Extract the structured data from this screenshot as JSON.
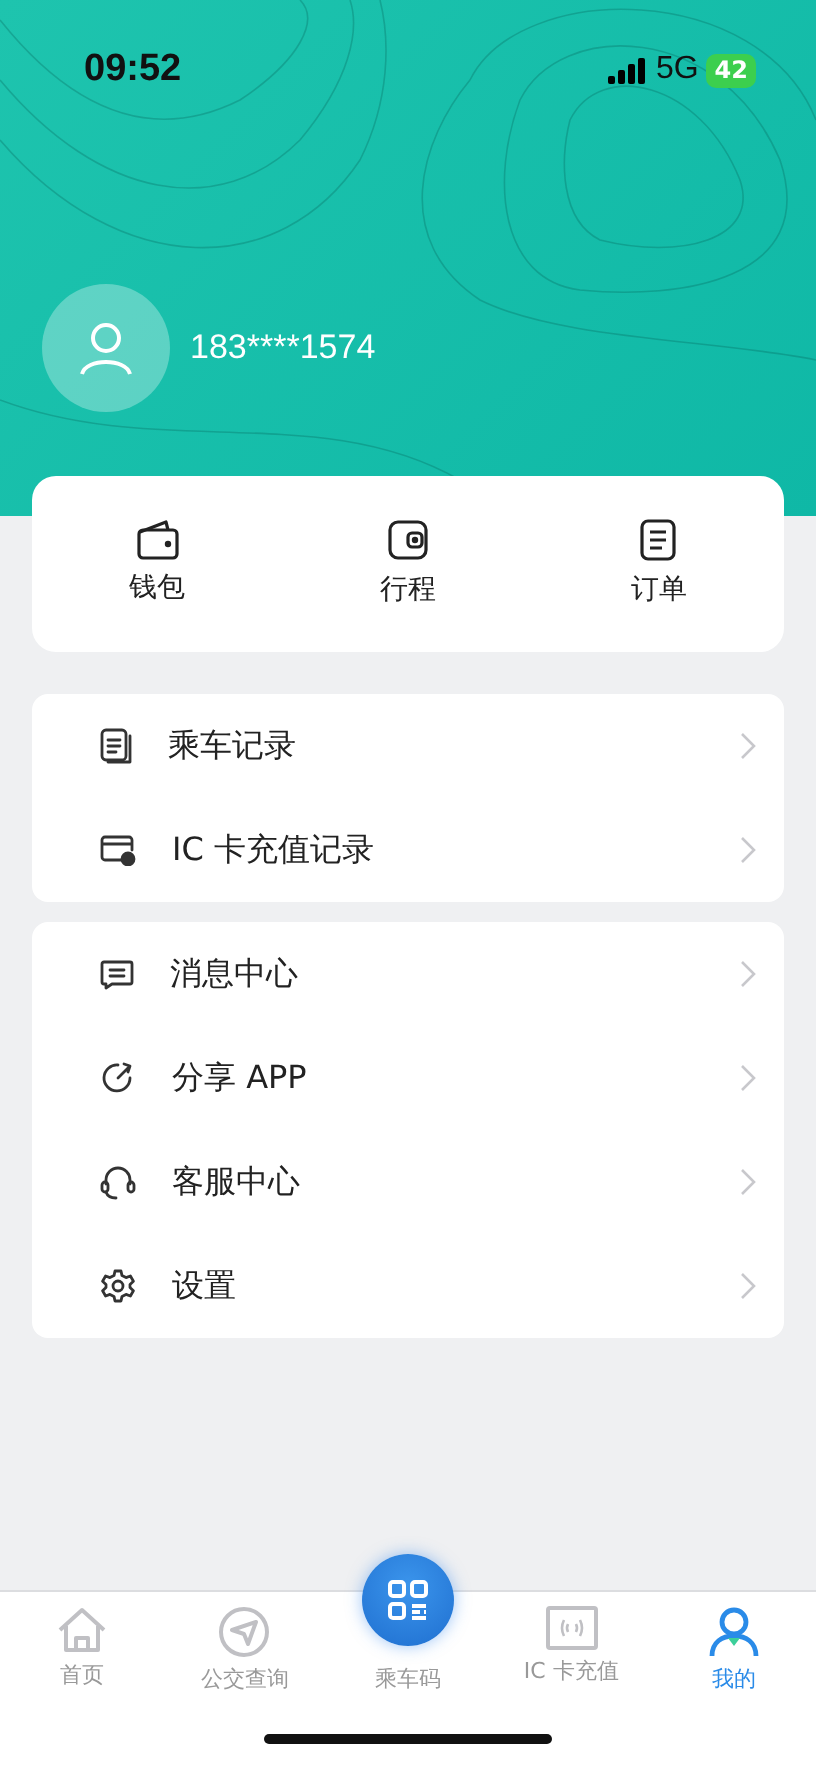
{
  "status_bar": {
    "time": "09:52",
    "network": "5G",
    "battery": "42"
  },
  "profile": {
    "phone": "183****1574"
  },
  "quick_actions": [
    {
      "label": "钱包"
    },
    {
      "label": "行程"
    },
    {
      "label": "订单"
    }
  ],
  "menu_groups": [
    [
      {
        "label": "乘车记录"
      },
      {
        "label": "IC 卡充值记录"
      }
    ],
    [
      {
        "label": "消息中心"
      },
      {
        "label": "分享 APP"
      },
      {
        "label": "客服中心"
      },
      {
        "label": "设置"
      }
    ]
  ],
  "tab_bar": [
    {
      "label": "首页",
      "kind": "normal",
      "selected": false
    },
    {
      "label": "公交查询",
      "kind": "normal",
      "selected": false
    },
    {
      "label": "乘车码",
      "kind": "center",
      "selected": false
    },
    {
      "label": "IC 卡充值",
      "kind": "normal",
      "selected": false
    },
    {
      "label": "我的",
      "kind": "normal",
      "selected": true
    }
  ]
}
